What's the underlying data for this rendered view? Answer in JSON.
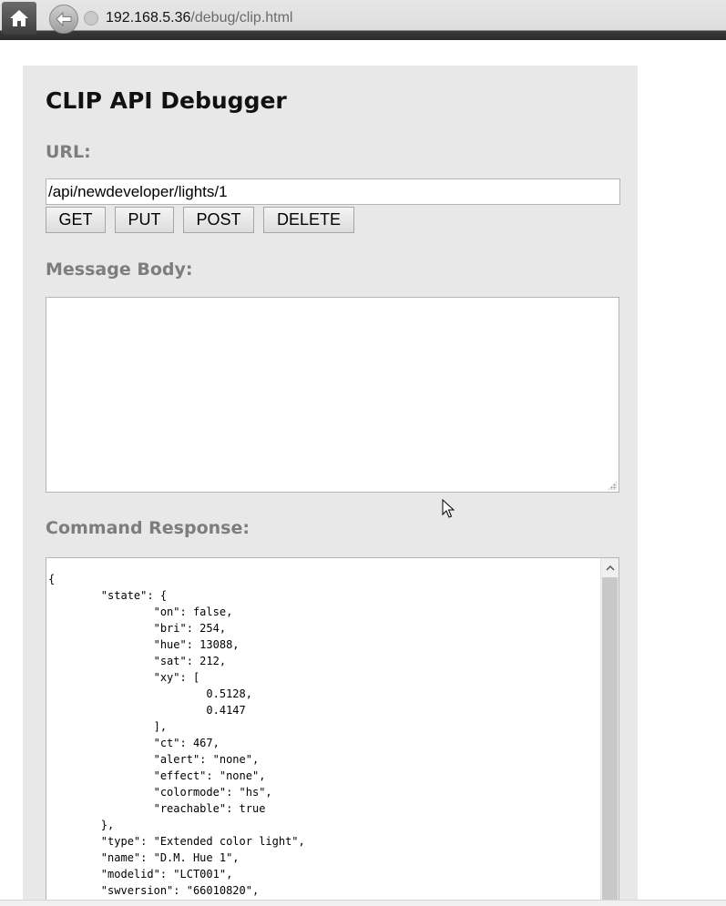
{
  "browser": {
    "url_host": "192.168.5.36",
    "url_path": "/debug/clip.html"
  },
  "page": {
    "title": "CLIP API Debugger",
    "url_label": "URL:",
    "url_value": "/api/newdeveloper/lights/1",
    "buttons": {
      "get": "GET",
      "put": "PUT",
      "post": "POST",
      "delete": "DELETE"
    },
    "message_body_label": "Message Body:",
    "message_body_value": "",
    "command_response_label": "Command Response:",
    "command_response_text": "{\n\t\"state\": {\n\t\t\"on\": false,\n\t\t\"bri\": 254,\n\t\t\"hue\": 13088,\n\t\t\"sat\": 212,\n\t\t\"xy\": [\n\t\t\t0.5128,\n\t\t\t0.4147\n\t\t],\n\t\t\"ct\": 467,\n\t\t\"alert\": \"none\",\n\t\t\"effect\": \"none\",\n\t\t\"colormode\": \"hs\",\n\t\t\"reachable\": true\n\t},\n\t\"type\": \"Extended color light\",\n\t\"name\": \"D.M. Hue 1\",\n\t\"modelid\": \"LCT001\",\n\t\"swversion\": \"66010820\","
  },
  "icons": {
    "home": "home-icon",
    "back": "back-arrow-icon",
    "site": "globe-icon",
    "scroll_up": "chevron-up-icon",
    "cursor": "mouse-cursor-icon",
    "resize": "resize-grip-icon"
  }
}
